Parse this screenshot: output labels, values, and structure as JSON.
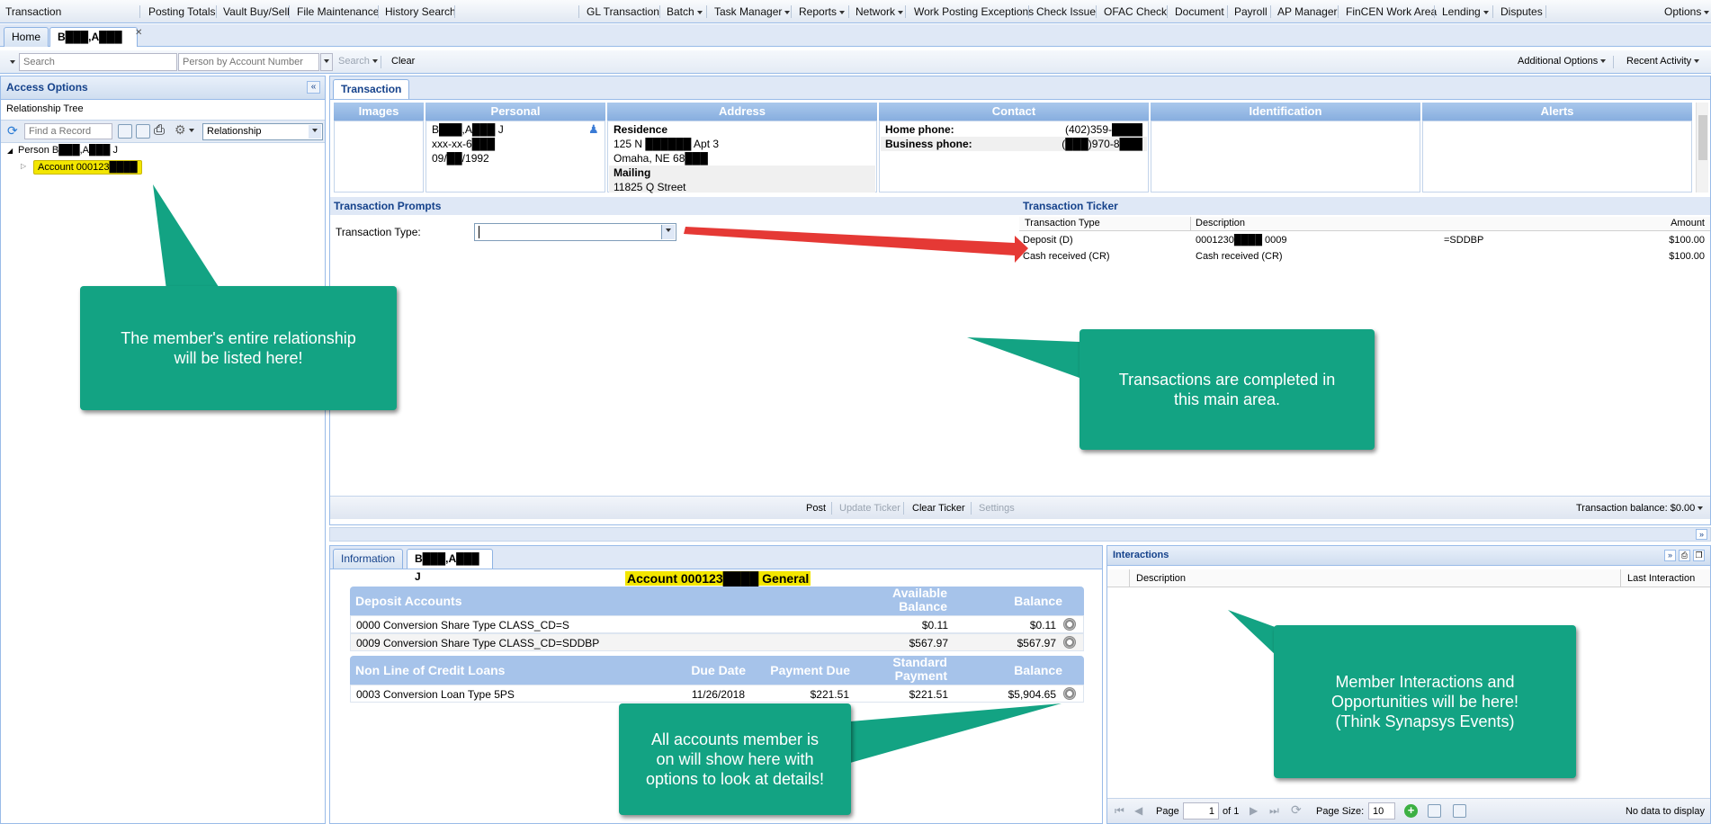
{
  "menubar": {
    "left": "Transaction",
    "items": [
      "Posting Totals",
      "Vault Buy/Sell",
      "File Maintenance",
      "History Search"
    ],
    "center": [
      "GL Transaction",
      "Batch",
      "Task Manager",
      "Reports",
      "Network",
      "Work Posting Exceptions",
      "Check Issue",
      "OFAC Check",
      "Document",
      "Payroll",
      "AP Manager",
      "FinCEN Work Area",
      "Lending",
      "Disputes"
    ],
    "right": "Options"
  },
  "tabs": {
    "home": "Home",
    "member": "B███,A███ J"
  },
  "toolbar": {
    "search_placeholder": "Search",
    "person_placeholder": "Person by Account Number",
    "search_btn": "Search",
    "clear_btn": "Clear",
    "additional": "Additional Options",
    "recent": "Recent Activity"
  },
  "left": {
    "title": "Access Options",
    "tree_label": "Relationship Tree",
    "find_placeholder": "Find a Record",
    "relationship": "Relationship",
    "person": "Person B███,A███ J",
    "account": "Account 000123████"
  },
  "main": {
    "tab": "Transaction",
    "headers": [
      "Images",
      "Personal",
      "Address",
      "Contact",
      "Identification",
      "Alerts"
    ],
    "personal": [
      "B███,A███ J",
      "xxx-xx-6███",
      "09/██/1992"
    ],
    "address": {
      "residence_label": "Residence",
      "residence_line": "125 N ██████ Apt 3",
      "city": "Omaha, NE 68███",
      "mailing_label": "Mailing",
      "mailing_line": "11825 Q Street"
    },
    "contact": {
      "home_label": "Home phone:",
      "home_val": "(402)359-████",
      "biz_label": "Business phone:",
      "biz_val": "(███)970-8███"
    },
    "prompts_title": "Transaction Prompts",
    "tx_type_label": "Transaction Type:",
    "ticker_title": "Transaction Ticker",
    "ticker_cols": [
      "Transaction Type",
      "Description",
      "Amount"
    ],
    "ticker_rows": [
      {
        "type": "Deposit (D)",
        "desc": "0001230████ 0009",
        "extra": "=SDDBP",
        "amount": "$100.00"
      },
      {
        "type": "Cash received (CR)",
        "desc": "Cash received (CR)",
        "extra": "",
        "amount": "$100.00"
      }
    ],
    "footer": {
      "post": "Post",
      "update": "Update Ticker",
      "clear": "Clear Ticker",
      "settings": "Settings",
      "balance": "Transaction balance: $0.00"
    }
  },
  "bottom": {
    "tab_info": "Information",
    "tab_member": "B███,A███ J",
    "account_title": "Account 000123████ General",
    "deposit": {
      "title": "Deposit Accounts",
      "col_avail": "Available Balance",
      "col_bal": "Balance",
      "rows": [
        {
          "name": "0000 Conversion Share Type CLASS_CD=S",
          "avail": "$0.11",
          "bal": "$0.11"
        },
        {
          "name": "0009 Conversion Share Type CLASS_CD=SDDBP",
          "avail": "$567.97",
          "bal": "$567.97"
        }
      ]
    },
    "loans": {
      "title": "Non Line of Credit Loans",
      "col_due": "Due Date",
      "col_pay": "Payment Due",
      "col_std": "Standard Payment",
      "col_bal": "Balance",
      "rows": [
        {
          "name": "0003 Conversion Loan Type 5PS",
          "due": "11/26/2018",
          "pay": "$221.51",
          "std": "$221.51",
          "bal": "$5,904.65"
        }
      ]
    }
  },
  "interactions": {
    "title": "Interactions",
    "col_desc": "Description",
    "col_last": "Last Interaction",
    "page_label": "Page",
    "page_val": "1",
    "of": "of 1",
    "size_label": "Page Size:",
    "size_val": "10",
    "empty": "No data to display"
  },
  "callouts": {
    "relationship": "The member's entire relationship will be listed here!",
    "transactions": "Transactions are completed in this main area.",
    "accounts": "All accounts member is on will show here with options to look at details!",
    "interactions": "Member Interactions and Opportunities will be here! (Think Synapsys Events)"
  },
  "colors": {
    "accent": "#15428b",
    "callout": "#13a383",
    "highlight": "#f3e600",
    "arrow": "#e53935"
  }
}
